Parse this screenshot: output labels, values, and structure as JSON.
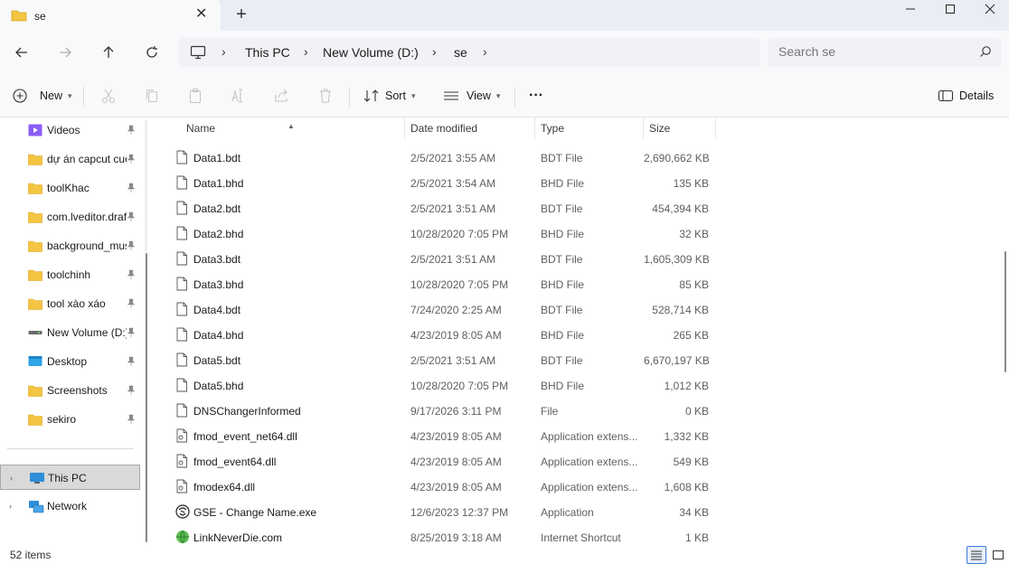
{
  "window": {
    "tab_title": "se",
    "new_tab": "+"
  },
  "address": {
    "crumbs": [
      "This PC",
      "New Volume (D:)",
      "se"
    ],
    "search_placeholder": "Search se"
  },
  "commands": {
    "new": "New",
    "sort": "Sort",
    "view": "View",
    "more": "···",
    "details": "Details"
  },
  "sidebar": {
    "quick": [
      {
        "label": "Videos",
        "icon": "videos-folder-icon"
      },
      {
        "label": "dự án capcut cuối",
        "icon": "folder-icon"
      },
      {
        "label": "toolKhac",
        "icon": "folder-icon"
      },
      {
        "label": "com.lveditor.draft",
        "icon": "folder-icon"
      },
      {
        "label": "background_music",
        "icon": "folder-icon"
      },
      {
        "label": "toolchinh",
        "icon": "folder-icon"
      },
      {
        "label": "tool xào xáo",
        "icon": "folder-icon"
      },
      {
        "label": "New Volume (D:)",
        "icon": "drive-icon"
      },
      {
        "label": "Desktop",
        "icon": "desktop-folder-icon"
      },
      {
        "label": "Screenshots",
        "icon": "folder-icon"
      },
      {
        "label": "sekiro",
        "icon": "folder-icon"
      }
    ],
    "this_pc": "This PC",
    "network": "Network"
  },
  "columns": {
    "name": "Name",
    "date": "Date modified",
    "type": "Type",
    "size": "Size"
  },
  "files": [
    {
      "name": "Data1.bdt",
      "date": "2/5/2021 3:55 AM",
      "type": "BDT File",
      "size": "2,690,662 KB",
      "icon": "file-icon"
    },
    {
      "name": "Data1.bhd",
      "date": "2/5/2021 3:54 AM",
      "type": "BHD File",
      "size": "135 KB",
      "icon": "file-icon"
    },
    {
      "name": "Data2.bdt",
      "date": "2/5/2021 3:51 AM",
      "type": "BDT File",
      "size": "454,394 KB",
      "icon": "file-icon"
    },
    {
      "name": "Data2.bhd",
      "date": "10/28/2020 7:05 PM",
      "type": "BHD File",
      "size": "32 KB",
      "icon": "file-icon"
    },
    {
      "name": "Data3.bdt",
      "date": "2/5/2021 3:51 AM",
      "type": "BDT File",
      "size": "1,605,309 KB",
      "icon": "file-icon"
    },
    {
      "name": "Data3.bhd",
      "date": "10/28/2020 7:05 PM",
      "type": "BHD File",
      "size": "85 KB",
      "icon": "file-icon"
    },
    {
      "name": "Data4.bdt",
      "date": "7/24/2020 2:25 AM",
      "type": "BDT File",
      "size": "528,714 KB",
      "icon": "file-icon"
    },
    {
      "name": "Data4.bhd",
      "date": "4/23/2019 8:05 AM",
      "type": "BHD File",
      "size": "265 KB",
      "icon": "file-icon"
    },
    {
      "name": "Data5.bdt",
      "date": "2/5/2021 3:51 AM",
      "type": "BDT File",
      "size": "6,670,197 KB",
      "icon": "file-icon"
    },
    {
      "name": "Data5.bhd",
      "date": "10/28/2020 7:05 PM",
      "type": "BHD File",
      "size": "1,012 KB",
      "icon": "file-icon"
    },
    {
      "name": "DNSChangerInformed",
      "date": "9/17/2026 3:11 PM",
      "type": "File",
      "size": "0 KB",
      "icon": "file-icon"
    },
    {
      "name": "fmod_event_net64.dll",
      "date": "4/23/2019 8:05 AM",
      "type": "Application extens...",
      "size": "1,332 KB",
      "icon": "dll-icon"
    },
    {
      "name": "fmod_event64.dll",
      "date": "4/23/2019 8:05 AM",
      "type": "Application extens...",
      "size": "549 KB",
      "icon": "dll-icon"
    },
    {
      "name": "fmodex64.dll",
      "date": "4/23/2019 8:05 AM",
      "type": "Application extens...",
      "size": "1,608 KB",
      "icon": "dll-icon"
    },
    {
      "name": "GSE - Change Name.exe",
      "date": "12/6/2023 12:37 PM",
      "type": "Application",
      "size": "34 KB",
      "icon": "exe-icon"
    },
    {
      "name": "LinkNeverDie.com",
      "date": "8/25/2019 3:18 AM",
      "type": "Internet Shortcut",
      "size": "1 KB",
      "icon": "shortcut-icon"
    }
  ],
  "status": {
    "item_count": "52 items"
  },
  "colors": {
    "folder": "#f4c542",
    "accent": "#3a7bd5",
    "selected_bg": "#d9d9d9"
  }
}
